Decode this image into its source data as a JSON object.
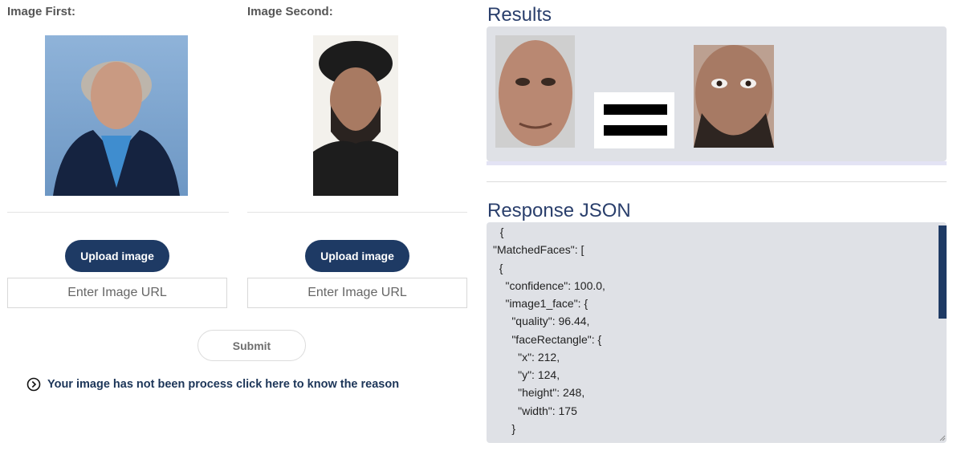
{
  "left_panel": {
    "label": "Image First:",
    "upload_label": "Upload image",
    "url_placeholder": "Enter Image URL"
  },
  "middle_panel": {
    "label": "Image Second:",
    "upload_label": "Upload image",
    "url_placeholder": "Enter Image URL"
  },
  "submit_label": "Submit",
  "reason_link": {
    "icon": "chevron-circle-right-icon",
    "text": "Your image has not been process click here to know the reason"
  },
  "results": {
    "title": "Results"
  },
  "response_json": {
    "title": "Response JSON",
    "lines": [
      "  {",
      "\"MatchedFaces\": [",
      "  {",
      "    \"confidence\": 100.0,",
      "    \"image1_face\": {",
      "      \"quality\": 96.44,",
      "      \"faceRectangle\": {",
      "        \"x\": 212,",
      "        \"y\": 124,",
      "        \"height\": 248,",
      "        \"width\": 175",
      "      }"
    ]
  },
  "colors": {
    "primary_button": "#1e3a64",
    "title_blue": "#2a3f6c",
    "panel_bg": "#dfe1e6",
    "link_text": "#1c3558"
  }
}
